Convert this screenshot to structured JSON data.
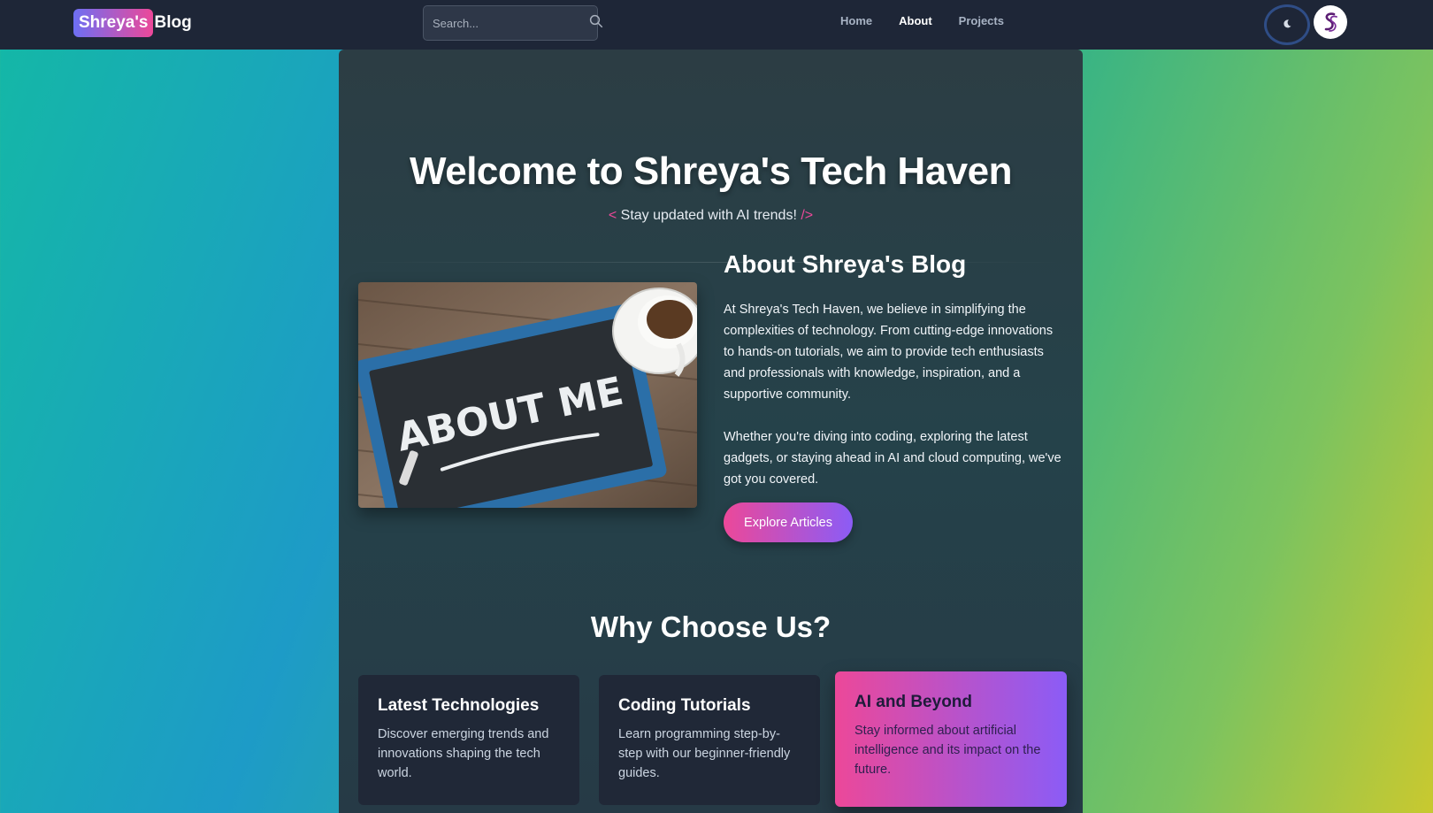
{
  "navbar": {
    "logo_badge": "Shreya's",
    "logo_text": "Blog",
    "search_placeholder": "Search...",
    "links": [
      {
        "label": "Home",
        "active": false
      },
      {
        "label": "About",
        "active": true
      },
      {
        "label": "Projects",
        "active": false
      }
    ],
    "theme_icon": "moon-icon",
    "avatar_icon": "ss-monogram-icon"
  },
  "hero": {
    "title": "Welcome to Shreya's Tech Haven",
    "subtitle_open": "<",
    "subtitle": "Stay updated with AI trends!",
    "subtitle_close": "/>"
  },
  "about": {
    "image_text": "ABOUT ME",
    "heading": "About Shreya's Blog",
    "paragraph1": "At Shreya's Tech Haven, we believe in simplifying the complexities of technology. From cutting-edge innovations to hands-on tutorials, we aim to provide tech enthusiasts and professionals with knowledge, inspiration, and a supportive community.",
    "paragraph2": "Whether you're diving into coding, exploring the latest gadgets, or staying ahead in AI and cloud computing, we've got you covered.",
    "cta_label": "Explore Articles"
  },
  "why": {
    "heading": "Why Choose Us?",
    "features": [
      {
        "title": "Latest Technologies",
        "text": "Discover emerging trends and innovations shaping the tech world."
      },
      {
        "title": "Coding Tutorials",
        "text": "Learn programming step-by-step with our beginner-friendly guides."
      },
      {
        "title": "AI and Beyond",
        "text": "Stay informed about artificial intelligence and its impact on the future."
      }
    ]
  },
  "colors": {
    "accent_pink": "#ec4899",
    "accent_purple": "#8b5cf6",
    "navbar_bg": "#1e2637",
    "card_bg": "#202837"
  }
}
